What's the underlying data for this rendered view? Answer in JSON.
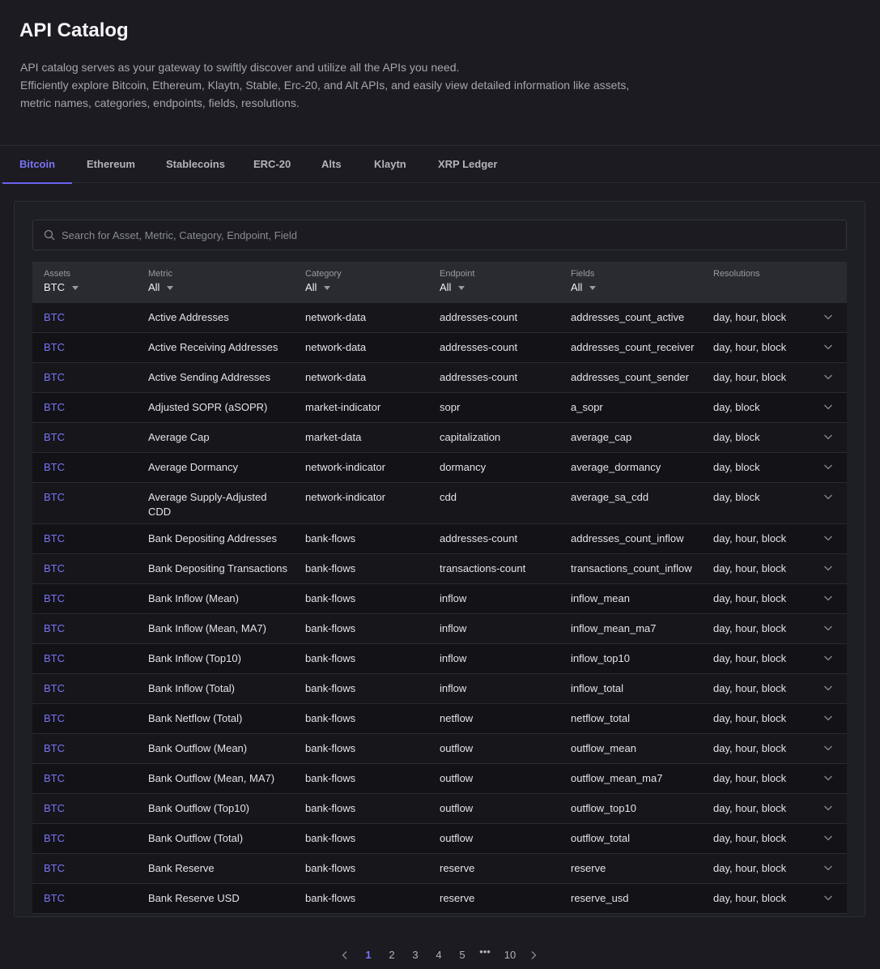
{
  "header": {
    "title": "API Catalog",
    "description_lines": [
      "API catalog serves as your gateway to swiftly discover and utilize all the APIs you need.",
      "Efficiently explore Bitcoin, Ethereum, Klaytn, Stable, Erc-20, and Alt APIs, and easily view detailed information like assets,",
      "metric names, categories, endpoints, fields, resolutions."
    ]
  },
  "tabs": [
    {
      "label": "Bitcoin",
      "active": true
    },
    {
      "label": "Ethereum"
    },
    {
      "label": "Stablecoins"
    },
    {
      "label": "ERC-20"
    },
    {
      "label": "Alts"
    },
    {
      "label": "Klaytn"
    },
    {
      "label": "XRP Ledger"
    }
  ],
  "search": {
    "placeholder": "Search for Asset, Metric, Category, Endpoint, Field",
    "value": ""
  },
  "columns": [
    {
      "label": "Assets",
      "filter": "BTC"
    },
    {
      "label": "Metric",
      "filter": "All"
    },
    {
      "label": "Category",
      "filter": "All"
    },
    {
      "label": "Endpoint",
      "filter": "All"
    },
    {
      "label": "Fields",
      "filter": "All"
    },
    {
      "label": "Resolutions"
    }
  ],
  "rows": [
    [
      "BTC",
      "Active Addresses",
      "network-data",
      "addresses-count",
      "addresses_count_active",
      "day, hour, block"
    ],
    [
      "BTC",
      "Active Receiving Addresses",
      "network-data",
      "addresses-count",
      "addresses_count_receiver",
      "day, hour, block"
    ],
    [
      "BTC",
      "Active Sending Addresses",
      "network-data",
      "addresses-count",
      "addresses_count_sender",
      "day, hour, block"
    ],
    [
      "BTC",
      "Adjusted SOPR (aSOPR)",
      "market-indicator",
      "sopr",
      "a_sopr",
      "day, block"
    ],
    [
      "BTC",
      "Average Cap",
      "market-data",
      "capitalization",
      "average_cap",
      "day, block"
    ],
    [
      "BTC",
      "Average Dormancy",
      "network-indicator",
      "dormancy",
      "average_dormancy",
      "day, block"
    ],
    [
      "BTC",
      "Average Supply-Adjusted CDD",
      "network-indicator",
      "cdd",
      "average_sa_cdd",
      "day, block"
    ],
    [
      "BTC",
      "Bank Depositing Addresses",
      "bank-flows",
      "addresses-count",
      "addresses_count_inflow",
      "day, hour, block"
    ],
    [
      "BTC",
      "Bank Depositing Transactions",
      "bank-flows",
      "transactions-count",
      "transactions_count_inflow",
      "day, hour, block"
    ],
    [
      "BTC",
      "Bank Inflow (Mean)",
      "bank-flows",
      "inflow",
      "inflow_mean",
      "day, hour, block"
    ],
    [
      "BTC",
      "Bank Inflow (Mean, MA7)",
      "bank-flows",
      "inflow",
      "inflow_mean_ma7",
      "day, hour, block"
    ],
    [
      "BTC",
      "Bank Inflow (Top10)",
      "bank-flows",
      "inflow",
      "inflow_top10",
      "day, hour, block"
    ],
    [
      "BTC",
      "Bank Inflow (Total)",
      "bank-flows",
      "inflow",
      "inflow_total",
      "day, hour, block"
    ],
    [
      "BTC",
      "Bank Netflow (Total)",
      "bank-flows",
      "netflow",
      "netflow_total",
      "day, hour, block"
    ],
    [
      "BTC",
      "Bank Outflow (Mean)",
      "bank-flows",
      "outflow",
      "outflow_mean",
      "day, hour, block"
    ],
    [
      "BTC",
      "Bank Outflow (Mean, MA7)",
      "bank-flows",
      "outflow",
      "outflow_mean_ma7",
      "day, hour, block"
    ],
    [
      "BTC",
      "Bank Outflow (Top10)",
      "bank-flows",
      "outflow",
      "outflow_top10",
      "day, hour, block"
    ],
    [
      "BTC",
      "Bank Outflow (Total)",
      "bank-flows",
      "outflow",
      "outflow_total",
      "day, hour, block"
    ],
    [
      "BTC",
      "Bank Reserve",
      "bank-flows",
      "reserve",
      "reserve",
      "day, hour, block"
    ],
    [
      "BTC",
      "Bank Reserve USD",
      "bank-flows",
      "reserve",
      "reserve_usd",
      "day, hour, block"
    ]
  ],
  "pagination": {
    "pages": [
      "1",
      "2",
      "3",
      "4",
      "5",
      "•••",
      "10"
    ],
    "current": "1"
  },
  "icons": {
    "search": "search-icon",
    "expand": "chevron-down-icon",
    "prev": "chevron-left-icon",
    "next": "chevron-right-icon"
  },
  "colors": {
    "accent": "#7b74f5",
    "background": "#1b1b21"
  }
}
